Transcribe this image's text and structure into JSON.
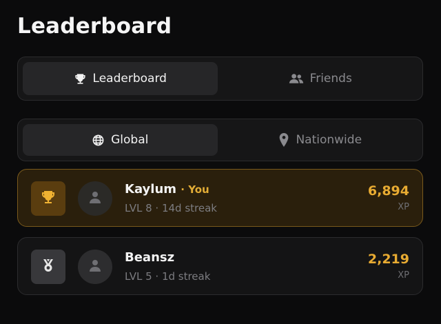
{
  "page": {
    "title": "Leaderboard"
  },
  "tabs": [
    {
      "label": "Leaderboard",
      "icon": "trophy-icon",
      "active": true
    },
    {
      "label": "Friends",
      "icon": "users-icon",
      "active": false
    }
  ],
  "scope": [
    {
      "label": "Global",
      "icon": "globe-icon",
      "active": true
    },
    {
      "label": "Nationwide",
      "icon": "map-pin-icon",
      "active": false
    }
  ],
  "entries": [
    {
      "name": "Kaylum",
      "you_label": "· You",
      "level_streak": "LVL 8 · 14d streak",
      "xp": "6,894",
      "xp_unit": "XP",
      "rank_icon": "trophy-icon",
      "avatar_icon": "person-icon",
      "is_current_user": true
    },
    {
      "name": "Beansz",
      "level_streak": "LVL 5 · 1d streak",
      "xp": "2,219",
      "xp_unit": "XP",
      "rank_icon": "medal-icon",
      "avatar_icon": "person-icon",
      "is_current_user": false
    }
  ],
  "colors": {
    "background": "#0b0b0c",
    "accent_gold": "#e8ab32",
    "highlight_card": "#2a1f0c",
    "highlight_border": "#7a5a1c"
  }
}
